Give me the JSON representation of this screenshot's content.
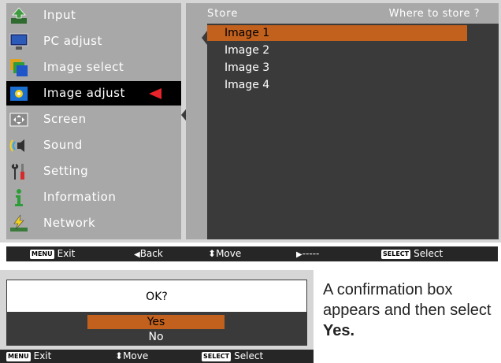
{
  "menu": {
    "items": [
      {
        "label": "Input",
        "icon": "input-icon"
      },
      {
        "label": "PC adjust",
        "icon": "pc-adjust-icon"
      },
      {
        "label": "Image select",
        "icon": "image-select-icon"
      },
      {
        "label": "Image adjust",
        "icon": "image-adjust-icon",
        "active": true
      },
      {
        "label": "Screen",
        "icon": "screen-icon"
      },
      {
        "label": "Sound",
        "icon": "sound-icon"
      },
      {
        "label": "Setting",
        "icon": "setting-icon"
      },
      {
        "label": "Information",
        "icon": "information-icon"
      },
      {
        "label": "Network",
        "icon": "network-icon"
      }
    ]
  },
  "panel": {
    "title": "Store",
    "subtitle": "Where to store ?",
    "items": [
      "Image 1",
      "Image 2",
      "Image 3",
      "Image 4"
    ],
    "selected_index": 0
  },
  "status_bar": {
    "exit_key": "MENU",
    "exit": "Exit",
    "back_glyph": "◀",
    "back": "Back",
    "move_glyph": "⬍",
    "move": "Move",
    "next_glyph": "▶",
    "next": "-----",
    "select_key": "SELECT",
    "select": "Select"
  },
  "dialog": {
    "question": "OK?",
    "yes": "Yes",
    "no": "No",
    "bar": {
      "exit_key": "MENU",
      "exit": "Exit",
      "move_glyph": "⬍",
      "move": "Move",
      "select_key": "SELECT",
      "select": "Select"
    }
  },
  "caption": {
    "text": "A confirmation box appears and then select ",
    "bold": "Yes."
  },
  "colors": {
    "highlight": "#c2611d",
    "active_arrow": "#e8232b",
    "panel_bg": "#3a3a3a",
    "frame_bg": "#a8a8a8"
  }
}
